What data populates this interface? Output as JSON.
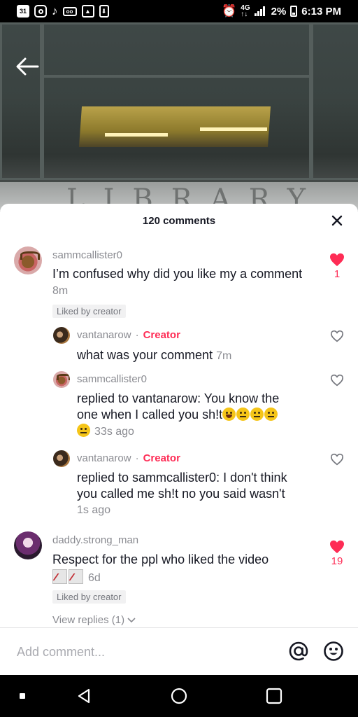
{
  "status_bar": {
    "calendar_date": "31",
    "battery": "2%",
    "time": "6:13 PM",
    "left_icons": [
      "calendar-icon",
      "instagram-icon",
      "tiktok-icon",
      "voicemail-icon",
      "gallery-icon",
      "download-icon"
    ],
    "right_icons": [
      "alarm-icon",
      "network-4g-icon",
      "signal-icon",
      "battery-icon"
    ]
  },
  "video": {
    "sign_text": "LIBRARY",
    "back_icon": "back-arrow-icon"
  },
  "sheet": {
    "title": "120 comments",
    "close_icon": "close-icon"
  },
  "comments": [
    {
      "user": "sammcallister0",
      "text": "I’m confused why did you like my a comment",
      "time": "8m",
      "liked_badge": "Liked by creator",
      "likes": "1",
      "liked": true,
      "replies": [
        {
          "user": "vantanarow",
          "dot": "·",
          "creator_tag": "Creator",
          "text": "what was your comment",
          "time": "7m"
        },
        {
          "user": "sammcallister0",
          "text_line1": "replied to vantanarow: You know the",
          "text_line2": "one when I called you sh!t",
          "time": "33s ago",
          "emojis": [
            "grinning-sweat-emoji",
            "neutral-face-emoji",
            "neutral-face-emoji",
            "neutral-face-emoji",
            "neutral-face-emoji"
          ]
        },
        {
          "user": "vantanarow",
          "dot": "·",
          "creator_tag": "Creator",
          "text_line1": "replied to sammcallister0: I don't think",
          "text_line2": "you called me sh!t no you said wasn't",
          "time": "1s ago"
        }
      ]
    },
    {
      "user": "daddy.strong_man",
      "text": "Respect for the ppl who liked the video",
      "time": "6d",
      "liked_badge": "Liked by creator",
      "likes": "19",
      "liked": true,
      "view_replies": "View replies (1)",
      "emojis": [
        "chart-decreasing-emoji",
        "chart-decreasing-emoji"
      ]
    }
  ],
  "add_comment": {
    "placeholder": "Add comment...",
    "at_icon": "at-mention-icon",
    "emoji_icon": "emoji-picker-icon"
  },
  "nav_bar": {
    "buttons": [
      "recents-button",
      "back-button",
      "home-button",
      "overview-button"
    ]
  },
  "colors": {
    "accent": "#fe2c55",
    "text_primary": "#161823",
    "text_secondary": "#8a8b91"
  }
}
